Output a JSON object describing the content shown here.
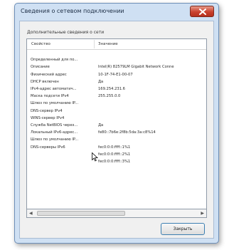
{
  "window": {
    "title": "Сведения о сетевом подключении",
    "close_icon": "close-x-icon"
  },
  "group_label": "Дополнительные сведения о сети",
  "columns": {
    "property": "Свойство",
    "value": "Значение"
  },
  "rows": [
    {
      "property": "",
      "value": ""
    },
    {
      "property": "Определенный для по...",
      "value": ""
    },
    {
      "property": "Описание",
      "value": "Intel(R) 82579LM Gigabit Network Conne"
    },
    {
      "property": "Физический адрес",
      "value": "10-1F-74-E1-00-07"
    },
    {
      "property": "DHCP включен",
      "value": "Да"
    },
    {
      "property": "IPv4-адрес автоматич...",
      "value": "169.254.231.6"
    },
    {
      "property": "Маска подсети IPv4",
      "value": "255.255.0.0"
    },
    {
      "property": "Шлюз по умолчанию IP...",
      "value": ""
    },
    {
      "property": "DNS-сервер IPv4",
      "value": ""
    },
    {
      "property": "WINS-сервер IPv4",
      "value": ""
    },
    {
      "property": "Служба NetBIOS через...",
      "value": "Да"
    },
    {
      "property": "Локальный IPv6-адрес...",
      "value": "fe80::7b6e:2f8b:5da:3a:c8%14"
    },
    {
      "property": "Шлюз по умолчанию IP...",
      "value": ""
    },
    {
      "property": "DNS-серверы IPv6",
      "value": "fec0:0:0:ffff::1%1"
    },
    {
      "property": "",
      "value": "fec0:0:0:ffff::2%1"
    },
    {
      "property": "",
      "value": "fec0:0:0:ffff::3%1"
    }
  ],
  "close_button": "Закрыть",
  "scroll_fraction_visible": 0.55
}
